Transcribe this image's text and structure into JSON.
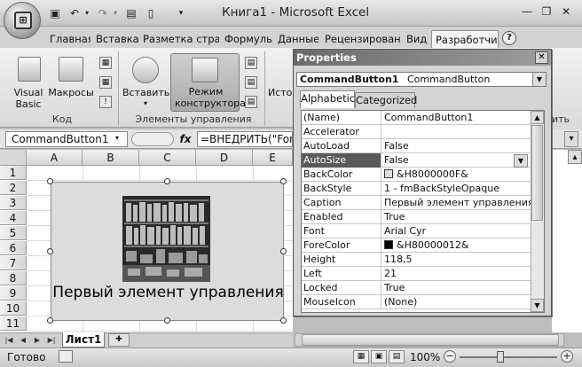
{
  "window": {
    "title": "Книга1 - Microsoft Excel"
  },
  "ribbon": {
    "tabs": [
      {
        "label": "Главная",
        "active": false
      },
      {
        "label": "Вставка",
        "active": false
      },
      {
        "label": "Разметка страни",
        "active": false
      },
      {
        "label": "Формулы",
        "active": false
      },
      {
        "label": "Данные",
        "active": false
      },
      {
        "label": "Рецензировани",
        "active": false
      },
      {
        "label": "Вид",
        "active": false
      },
      {
        "label": "Разработчик",
        "active": true
      }
    ],
    "groups": {
      "code": {
        "label": "Код",
        "visual_basic": "Visual Basic",
        "macros": "Макросы"
      },
      "controls": {
        "label": "Элементы управления",
        "insert": "Вставить",
        "design_mode": "Режим конструктора"
      },
      "partial_label": "Исто",
      "partial_group": "ить"
    }
  },
  "formula_bar": {
    "name_box": "CommandButton1",
    "fx": "fx",
    "formula": "=ВНЕДРИТЬ(\"For"
  },
  "grid": {
    "columns": [
      "A",
      "B",
      "C",
      "D",
      "E"
    ],
    "rows": [
      "1",
      "2",
      "3",
      "4",
      "5",
      "6",
      "7",
      "8",
      "9",
      "10",
      "11"
    ]
  },
  "command_button": {
    "caption": "Первый элемент управления"
  },
  "sheet_tabs": {
    "active": "Лист1"
  },
  "status_bar": {
    "text": "Готово",
    "zoom": "100%"
  },
  "properties": {
    "title": "Properties",
    "object": "CommandButton1 CommandButton",
    "object_name": "CommandButton1",
    "object_type": "CommandButton",
    "tabs": [
      "Alphabetic",
      "Categorized"
    ],
    "rows": [
      {
        "name": "(Name)",
        "value": "CommandButton1"
      },
      {
        "name": "Accelerator",
        "value": ""
      },
      {
        "name": "AutoLoad",
        "value": "False"
      },
      {
        "name": "AutoSize",
        "value": "False",
        "selected": true
      },
      {
        "name": "BackColor",
        "value": "&H8000000F&",
        "swatch": "#e0e0e0"
      },
      {
        "name": "BackStyle",
        "value": "1 - fmBackStyleOpaque"
      },
      {
        "name": "Caption",
        "value": "Первый элемент управления"
      },
      {
        "name": "Enabled",
        "value": "True"
      },
      {
        "name": "Font",
        "value": "Arial Cyr"
      },
      {
        "name": "ForeColor",
        "value": "&H80000012&",
        "swatch": "#000000"
      },
      {
        "name": "Height",
        "value": "118,5"
      },
      {
        "name": "Left",
        "value": "21"
      },
      {
        "name": "Locked",
        "value": "True"
      },
      {
        "name": "MouseIcon",
        "value": "(None)"
      }
    ]
  }
}
